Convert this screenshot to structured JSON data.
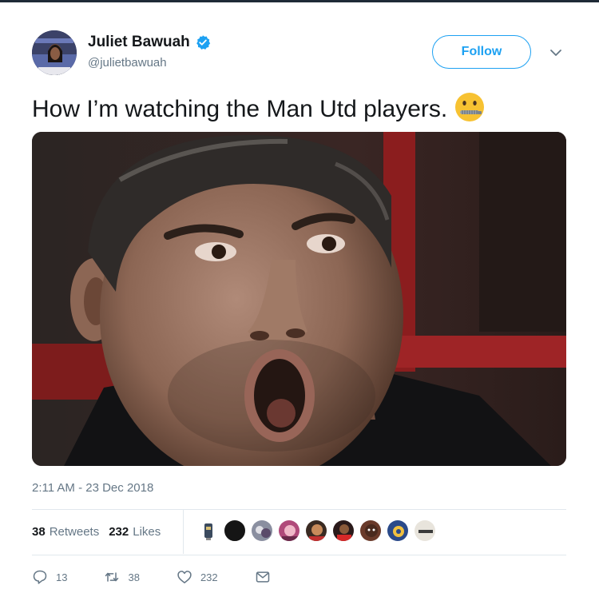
{
  "user": {
    "display_name": "Juliet Bawuah",
    "handle": "@julietbawuah",
    "verified": true
  },
  "follow_label": "Follow",
  "tweet_text": "How I’m watching the Man Utd players.",
  "emoji": "zipper-mouth-face",
  "media": {
    "description_icon": "photo-man-shocked-open-mouth"
  },
  "timestamp": "2:11 AM - 23 Dec 2018",
  "stats": {
    "retweets_count": "38",
    "retweets_label": "Retweets",
    "likes_count": "232",
    "likes_label": "Likes"
  },
  "actions": {
    "replies": "13",
    "retweets": "38",
    "likes": "232"
  },
  "colors": {
    "accent": "#1da1f2",
    "text": "#14171a",
    "muted": "#657786",
    "divider": "#e1e8ed"
  }
}
